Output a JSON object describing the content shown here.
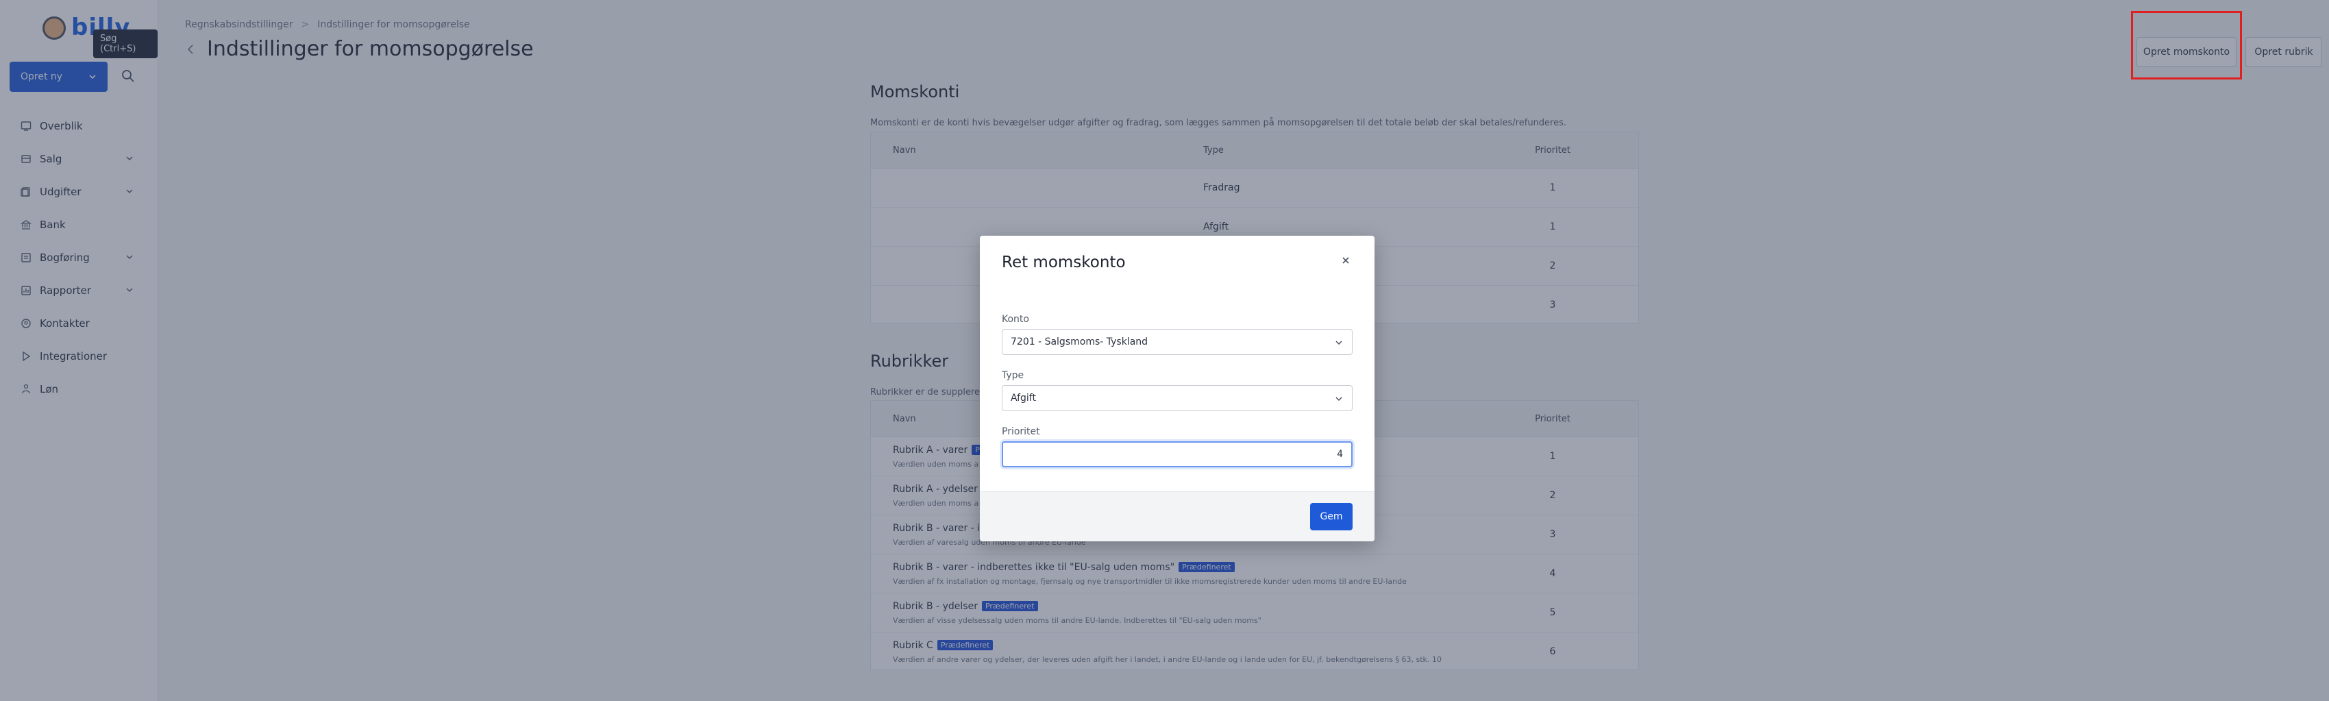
{
  "sidebar": {
    "logo_text": "billy",
    "tooltip": "Søg (Ctrl+S)",
    "create_label": "Opret ny",
    "items": [
      {
        "label": "Overblik"
      },
      {
        "label": "Salg"
      },
      {
        "label": "Udgifter"
      },
      {
        "label": "Bank"
      },
      {
        "label": "Bogføring"
      },
      {
        "label": "Rapporter"
      },
      {
        "label": "Kontakter"
      },
      {
        "label": "Integrationer"
      },
      {
        "label": "Løn"
      }
    ]
  },
  "header": {
    "breadcrumb": [
      "Regnskabsindstillinger",
      "Indstillinger for momsopgørelse"
    ],
    "title": "Indstillinger for momsopgørelse",
    "btn_create_account": "Opret momskonto",
    "btn_create_box": "Opret rubrik"
  },
  "momskonti": {
    "title": "Momskonti",
    "desc": "Momskonti er de konti hvis bevægelser udgør afgifter og fradrag, som lægges sammen på momsopgørelsen til det totale beløb der skal betales/refunderes.",
    "headers": [
      "Navn",
      "Type",
      "Prioritet"
    ],
    "rows": [
      {
        "name": "",
        "type": "Fradrag",
        "priority": "1"
      },
      {
        "name": "",
        "type": "Afgift",
        "priority": "1"
      },
      {
        "name": "",
        "type": "",
        "priority": "2"
      },
      {
        "name": "",
        "type": "",
        "priority": "3"
      }
    ]
  },
  "rubrikker": {
    "title": "Rubrikker",
    "desc": "Rubrikker er de supplerende",
    "headers": [
      "Navn",
      "Prioritet"
    ],
    "badge": "Prædefineret",
    "rows": [
      {
        "name": "Rubrik A - varer",
        "sub": "Værdien uden moms a",
        "priority": "1"
      },
      {
        "name": "Rubrik A - ydelser",
        "sub": "Værdien uden moms a",
        "priority": "2"
      },
      {
        "name": "Rubrik B - varer - indb",
        "sub": "Værdien af varesalg uden moms til andre EU-lande",
        "priority": "3"
      },
      {
        "name": "Rubrik B - varer - indberettes ikke til \"EU-salg uden moms\"",
        "sub": "Værdien af fx installation og montage, fjernsalg og nye transportmidler til ikke momsregistrerede kunder uden moms til andre EU-lande",
        "priority": "4"
      },
      {
        "name": "Rubrik B - ydelser",
        "sub": "Værdien af visse ydelsessalg uden moms til andre EU-lande. Indberettes til \"EU-salg uden moms\"",
        "priority": "5"
      },
      {
        "name": "Rubrik C",
        "sub": "Værdien af andre varer og ydelser, der leveres uden afgift her i landet, i andre EU-lande og i lande uden for EU, jf. bekendtgørelsens § 63, stk. 10",
        "priority": "6"
      }
    ]
  },
  "modal": {
    "title": "Ret momskonto",
    "konto_label": "Konto",
    "konto_value": "7201 - Salgsmoms- Tyskland",
    "type_label": "Type",
    "type_value": "Afgift",
    "priority_label": "Prioritet",
    "priority_value": "4",
    "save_label": "Gem"
  }
}
